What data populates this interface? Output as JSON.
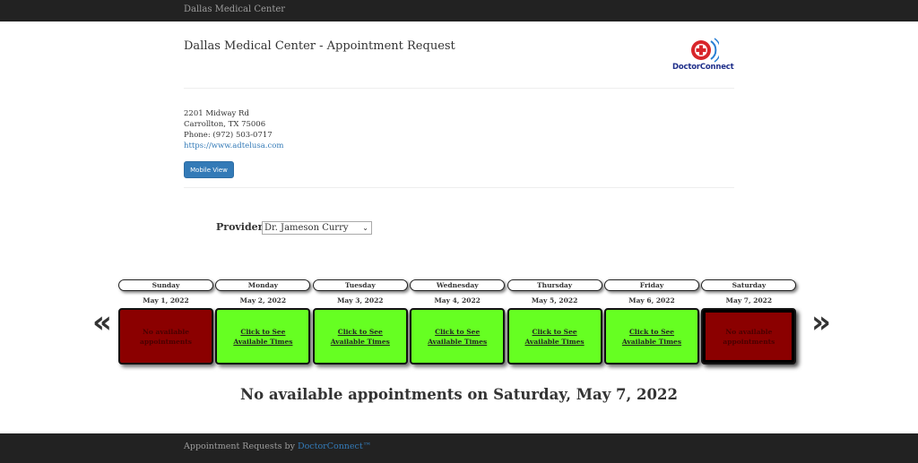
{
  "topbar": {
    "brand": "Dallas Medical Center"
  },
  "header": {
    "title": "Dallas Medical Center - Appointment Request",
    "logo_text": "DoctorConnect"
  },
  "address": {
    "line1": "2201 Midway Rd",
    "line2": "Carrollton, TX 75006",
    "phone": "Phone: (972) 503-0717",
    "website": "https://www.adtelusa.com"
  },
  "mobile_button": "Mobile View",
  "provider": {
    "label": "Provider",
    "selected": "Dr. Jameson Curry"
  },
  "nav": {
    "prev": "«",
    "next": "»"
  },
  "days": [
    {
      "day": "Sunday",
      "date": "May 1, 2022",
      "text": "No available appointments",
      "available": false
    },
    {
      "day": "Monday",
      "date": "May 2, 2022",
      "text": "Click to See Available Times",
      "available": true
    },
    {
      "day": "Tuesday",
      "date": "May 3, 2022",
      "text": "Click to See Available Times",
      "available": true
    },
    {
      "day": "Wednesday",
      "date": "May 4, 2022",
      "text": "Click to See Available Times",
      "available": true
    },
    {
      "day": "Thursday",
      "date": "May 5, 2022",
      "text": "Click to See Available Times",
      "available": true
    },
    {
      "day": "Friday",
      "date": "May 6, 2022",
      "text": "Click to See Available Times",
      "available": true
    },
    {
      "day": "Saturday",
      "date": "May 7, 2022",
      "text": "No available appointments",
      "available": false
    }
  ],
  "message": "No available appointments on Saturday, May 7, 2022",
  "footer": {
    "prefix": "Appointment Requests by ",
    "link": "DoctorConnect™"
  },
  "colors": {
    "available": "#66ff22",
    "unavailable": "#8b0000",
    "nav_bar": "#222222",
    "link": "#337ab7"
  }
}
